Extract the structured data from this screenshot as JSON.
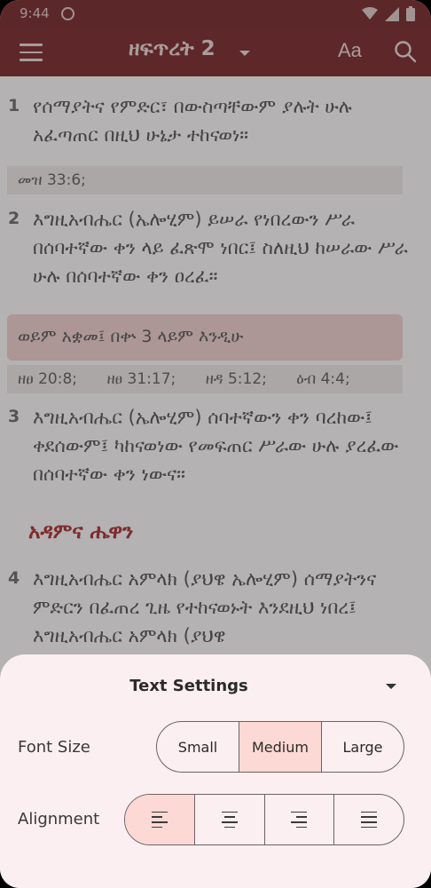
{
  "status_bar": {
    "time": "9:44"
  },
  "app_bar": {
    "title": "ዘፍጥረት 2",
    "font_button": "Aa"
  },
  "verses": [
    {
      "num": "1",
      "text": "የሰማያትና የምድር፣ በውስጣቸውም ያሉት ሁሉ አፈጣጠር በዚህ ሁኔታ ተከናወነ።"
    },
    {
      "num": "2",
      "text": "እግዚአብሔር (ኤሎሂም) ይሠራ የነበረውን ሥራ በሰባተኛው ቀን ላይ ፈጽሞ ነበር፤ ስለዚህ ከሠራው ሥራ ሁሉ በሰባተኛው ቀን ዐረፈ።"
    },
    {
      "num": "3",
      "text": "እግዚአብሔር (ኤሎሂም) ሰባተኛውን ቀን ባረከው፤ ቀደሰውም፤ ካከናወነው የመፍጠር ሥራው ሁሉ ያረፈው በሰባተኛው ቀን ነውና።"
    },
    {
      "num": "4",
      "text": "እግዚአብሔር አምላክ (ያህዌ ኤሎሂም) ሰማያትንና ምድርን በፈጠረ ጊዜ የተከናወኑት እንደዚህ ነበረ፤ እግዚአብሔር አምላክ (ያህዌ"
    }
  ],
  "refs_1": [
    "መዝ 33:6;"
  ],
  "note_2": "ወይም አቋመ፤ በቍ 3 ላይም እንዲሁ",
  "refs_2": [
    "ዘፀ 20:8;",
    "ዘፀ 31:17;",
    "ዘዳ 5:12;",
    "ዕብ 4:4;"
  ],
  "section_heading": "አዳምና ሔዋን",
  "sheet": {
    "title": "Text Settings",
    "font_size_label": "Font Size",
    "font_sizes": [
      "Small",
      "Medium",
      "Large"
    ],
    "selected_font_size": "Medium",
    "alignment_label": "Alignment",
    "alignments": [
      "align-left-icon",
      "align-center-icon",
      "align-right-icon",
      "align-justify-icon"
    ],
    "selected_alignment": "align-left-icon"
  },
  "colors": {
    "app_bar": "#701d20",
    "section_heading": "#a32226",
    "sheet_bg": "#fbeff1",
    "selected_segment": "#fcd9d4"
  }
}
